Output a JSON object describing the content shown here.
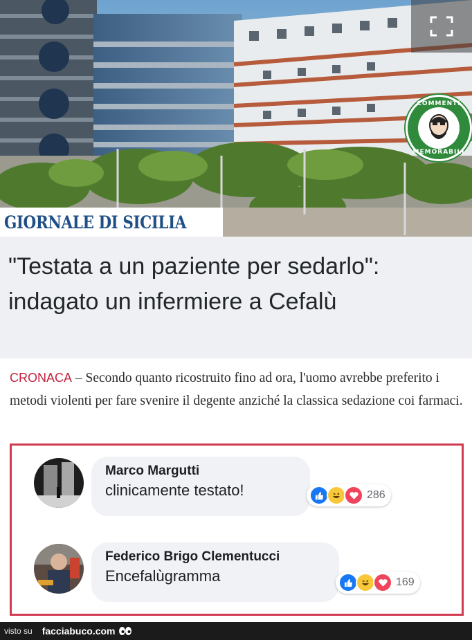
{
  "hero": {
    "image_icon": "building-photo",
    "expand_icon": "expand-icon",
    "badge": {
      "top": "COMMENTI",
      "bottom": "MEMORABILI",
      "color": "#2f8a3c"
    },
    "brand": "GIORNALE DI SICILIA",
    "brand_color": "#1f4f86"
  },
  "article": {
    "title": "\"Testata a un paziente per sedarlo\": indagato un infermiere a Cefalù",
    "category": "CRONACA",
    "separator": " – ",
    "summary": "Secondo quanto ricostruito fino ad ora, l'uomo avrebbe preferito i metodi violenti per fare svenire il degente anziché la classica sedazione coi farmaci.",
    "category_color": "#c3223e"
  },
  "comments": [
    {
      "author": "Marco Margutti",
      "text": "clinicamente testato!",
      "reaction_icons": [
        "like-icon",
        "haha-icon",
        "love-icon"
      ],
      "count": "286"
    },
    {
      "author": "Federico Brigo Clementucci",
      "text": "Encefalùgramma",
      "reaction_icons": [
        "like-icon",
        "haha-icon",
        "love-icon"
      ],
      "count": "169"
    }
  ],
  "comments_border_color": "#d23a52",
  "footer": {
    "prefix": "visto su",
    "site": "facciabuco.com",
    "logo_icon": "eyes-icon"
  }
}
